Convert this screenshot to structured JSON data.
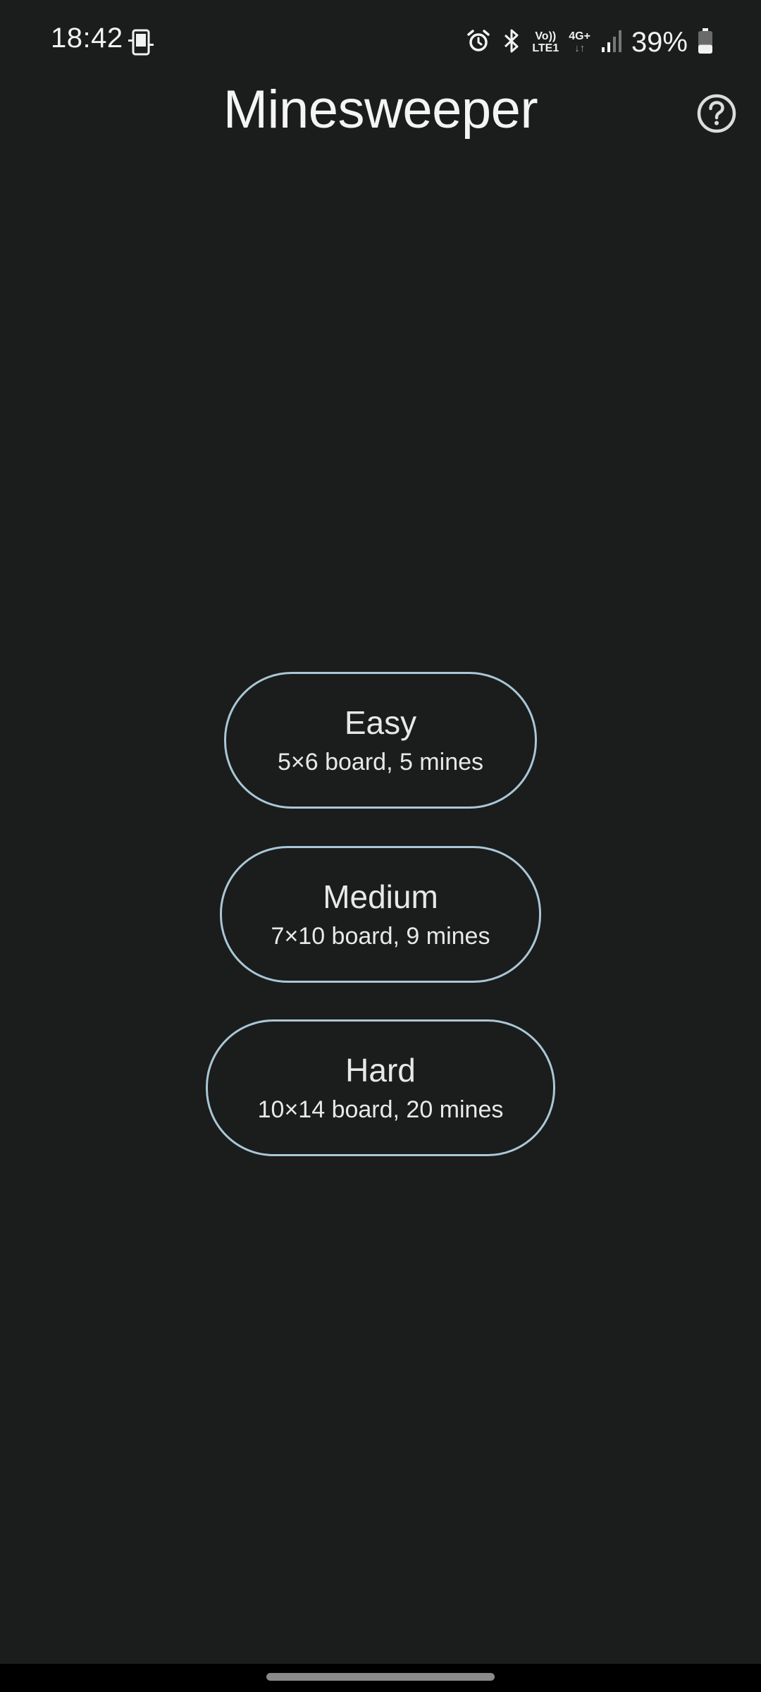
{
  "status_bar": {
    "time": "18:42",
    "left_icon": "phone-screen-icon",
    "icons": [
      "alarm-icon",
      "bluetooth-icon",
      "volte-icon",
      "4g-icon",
      "signal-icon"
    ],
    "volte_top": "Vo))",
    "volte_bottom": "LTE1",
    "net_top": "4G+",
    "net_bottom": "↓↑",
    "battery_percent": "39%",
    "battery_level": 0.39
  },
  "header": {
    "title": "Minesweeper",
    "help_icon": "help-circle-icon"
  },
  "difficulties": [
    {
      "name": "Easy",
      "description": "5×6 board, 5 mines"
    },
    {
      "name": "Medium",
      "description": "7×10 board, 9 mines"
    },
    {
      "name": "Hard",
      "description": "10×14 board, 20 mines"
    }
  ],
  "colors": {
    "background": "#1b1c1c",
    "button_outline": "#a9c7d6",
    "text": "#e8e8e8"
  }
}
